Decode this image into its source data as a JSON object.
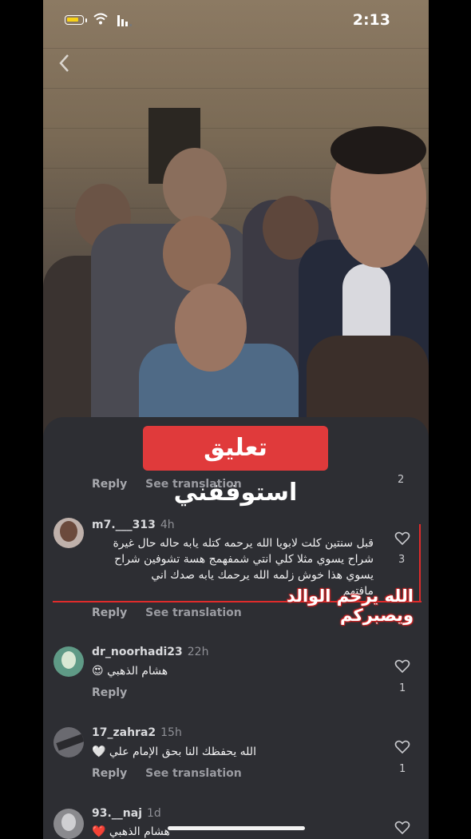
{
  "status_bar": {
    "time": "2:13"
  },
  "video": {
    "banner_text": "تعليق استوقفني"
  },
  "top_reply_row": {
    "reply_label": "Reply",
    "translate_label": "See translation",
    "like_count": "2"
  },
  "comments": [
    {
      "username": "m7.___313",
      "time": "4h",
      "lines": [
        "قبل سنتين كلت لابويا الله يرحمه كتله يابه حاله حال غيرة",
        "شراح يسوي مثلا كلي انتي شمفهمج هسة تشوفين شراح",
        "يسوي هذا خوش زلمه  الله يرحمك يابه صدك اني",
        "مافتهم"
      ],
      "reply_label": "Reply",
      "translate_label": "See translation",
      "like_count": "3"
    },
    {
      "username": "dr_noorhadi23",
      "time": "22h",
      "text": "هشام الذهبي",
      "emoji": "😍",
      "reply_label": "Reply",
      "like_count": "1"
    },
    {
      "username": "17_zahra2",
      "time": "15h",
      "text": "الله يحفظك النا بحق الإمام علي",
      "emoji": "🤍",
      "reply_label": "Reply",
      "translate_label": "See translation",
      "like_count": "1"
    },
    {
      "username": "93.__naj",
      "time": "1d",
      "text": "هشام الذهبي",
      "emoji": "❤️"
    }
  ],
  "overlay": {
    "caption": "الله يرحم الوالد ويصبركم"
  },
  "colors": {
    "sheet": "#2d2e33",
    "banner": "#e03a3b",
    "accent_red": "#e02b2b",
    "battery": "#f7d117"
  }
}
